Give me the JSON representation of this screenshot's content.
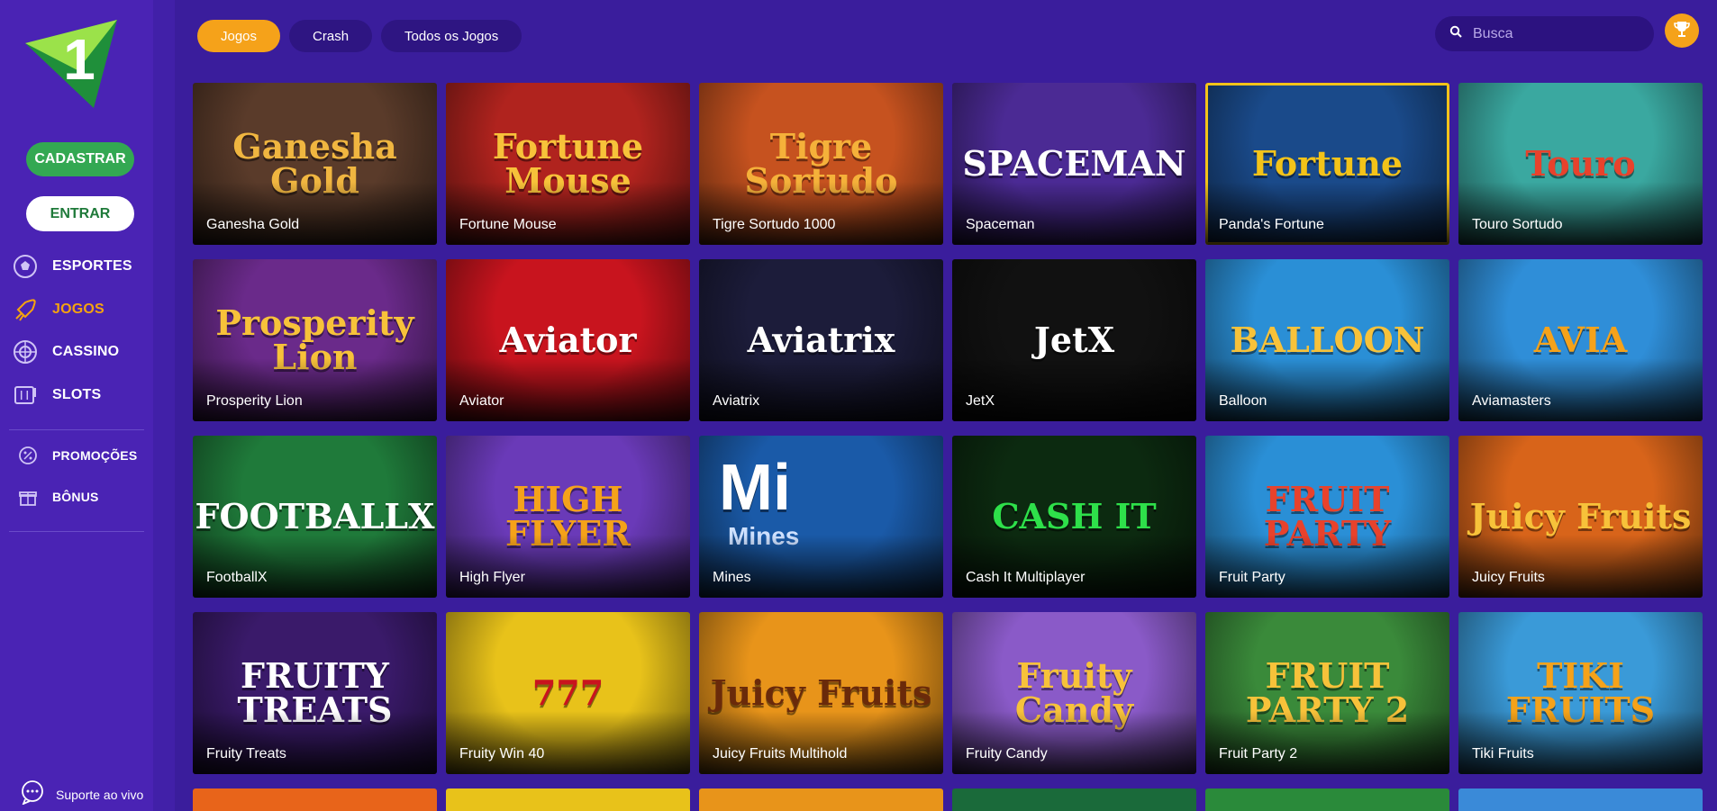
{
  "brand": {
    "logo_text": "1",
    "logo_colors": [
      "#9be24a",
      "#1f8f3a"
    ]
  },
  "auth": {
    "register_label": "CADASTRAR",
    "login_label": "ENTRAR"
  },
  "sidebar": {
    "items": [
      {
        "label": "ESPORTES",
        "icon": "soccer-ball-icon"
      },
      {
        "label": "JOGOS",
        "icon": "rocket-icon",
        "active": true
      },
      {
        "label": "CASSINO",
        "icon": "roulette-icon"
      },
      {
        "label": "SLOTS",
        "icon": "slot-machine-icon"
      }
    ],
    "secondary": [
      {
        "label": "PROMOÇÕES",
        "icon": "percent-badge-icon"
      },
      {
        "label": "BÔNUS",
        "icon": "gift-icon"
      }
    ],
    "support_label": "Suporte ao vivo"
  },
  "tabs": [
    {
      "label": "Jogos",
      "active": true
    },
    {
      "label": "Crash",
      "active": false
    },
    {
      "label": "Todos os Jogos",
      "active": false
    }
  ],
  "search": {
    "placeholder": "Busca"
  },
  "colors": {
    "accent": "#f5a21a",
    "sidebar": "#4a23b4",
    "background": "#3a1d9c",
    "register": "#33a852"
  },
  "games": [
    {
      "name": "Ganesha Gold",
      "art": "Ganesha Gold",
      "bg": "#5a3b2a",
      "fg": "#f0b640"
    },
    {
      "name": "Fortune Mouse",
      "art": "Fortune Mouse",
      "bg": "#b0231e",
      "fg": "#f7c23a"
    },
    {
      "name": "Tigre Sortudo 1000",
      "art": "Tigre Sortudo",
      "bg": "#c6521f",
      "fg": "#f5b13a"
    },
    {
      "name": "Spaceman",
      "art": "SPACEMAN",
      "bg": "#4b2a94",
      "fg": "#ffffff"
    },
    {
      "name": "Panda's Fortune",
      "art": "Fortune",
      "bg": "#1a4a8a",
      "fg": "#f3c319",
      "selected": true
    },
    {
      "name": "Touro Sortudo",
      "art": "Touro",
      "bg": "#3aa8a0",
      "fg": "#e8422c"
    },
    {
      "name": "Prosperity Lion",
      "art": "Prosperity Lion",
      "bg": "#6a2a8a",
      "fg": "#f7c23a"
    },
    {
      "name": "Aviator",
      "art": "Aviator",
      "bg": "#c8141e",
      "fg": "#ffffff"
    },
    {
      "name": "Aviatrix",
      "art": "Aviatrix",
      "bg": "#1c1c3a",
      "fg": "#ffffff"
    },
    {
      "name": "JetX",
      "art": "JetX",
      "bg": "#111111",
      "fg": "#ffffff"
    },
    {
      "name": "Balloon",
      "art": "BALLOON",
      "bg": "#2a8fd6",
      "fg": "#f7c23a"
    },
    {
      "name": "Aviamasters",
      "art": "AVIA",
      "bg": "#2f8ed8",
      "fg": "#f5a21a"
    },
    {
      "name": "FootballX",
      "art": "FOOTBALLX",
      "bg": "#1f7a3a",
      "fg": "#ffffff"
    },
    {
      "name": "High Flyer",
      "art": "HIGH FLYER",
      "bg": "#6a3ab8",
      "fg": "#f5a21a"
    },
    {
      "name": "Mines",
      "art": "Mi",
      "sub": "Mines",
      "bg": "#1a5aa8",
      "fg": "#ffffff"
    },
    {
      "name": "Cash It Multiplayer",
      "art": "CASH IT",
      "bg": "#0c2a10",
      "fg": "#2ee04a"
    },
    {
      "name": "Fruit Party",
      "art": "FRUIT PARTY",
      "bg": "#2a8fd6",
      "fg": "#e8422c"
    },
    {
      "name": "Juicy Fruits",
      "art": "Juicy Fruits",
      "bg": "#d8641a",
      "fg": "#f7c23a"
    },
    {
      "name": "Fruity Treats",
      "art": "FRUITY TREATS",
      "bg": "#3a1a6a",
      "fg": "#ffffff"
    },
    {
      "name": "Fruity Win 40",
      "art": "777",
      "bg": "#e8c21a",
      "fg": "#c8141e"
    },
    {
      "name": "Juicy Fruits Multihold",
      "art": "Juicy Fruits",
      "bg": "#e8941a",
      "fg": "#6a2a0a"
    },
    {
      "name": "Fruity Candy",
      "art": "Fruity Candy",
      "bg": "#8a5ac8",
      "fg": "#f7c23a"
    },
    {
      "name": "Fruit Party 2",
      "art": "FRUIT PARTY 2",
      "bg": "#3a8a3a",
      "fg": "#f7c23a"
    },
    {
      "name": "Tiki Fruits",
      "art": "TIKI FRUITS",
      "bg": "#3a9ad8",
      "fg": "#f5a21a"
    }
  ],
  "partial_row_colors": [
    "#e8641a",
    "#e8c21a",
    "#e8941a",
    "#1a6a3a",
    "#2a8a3a",
    "#3a8ad8"
  ]
}
